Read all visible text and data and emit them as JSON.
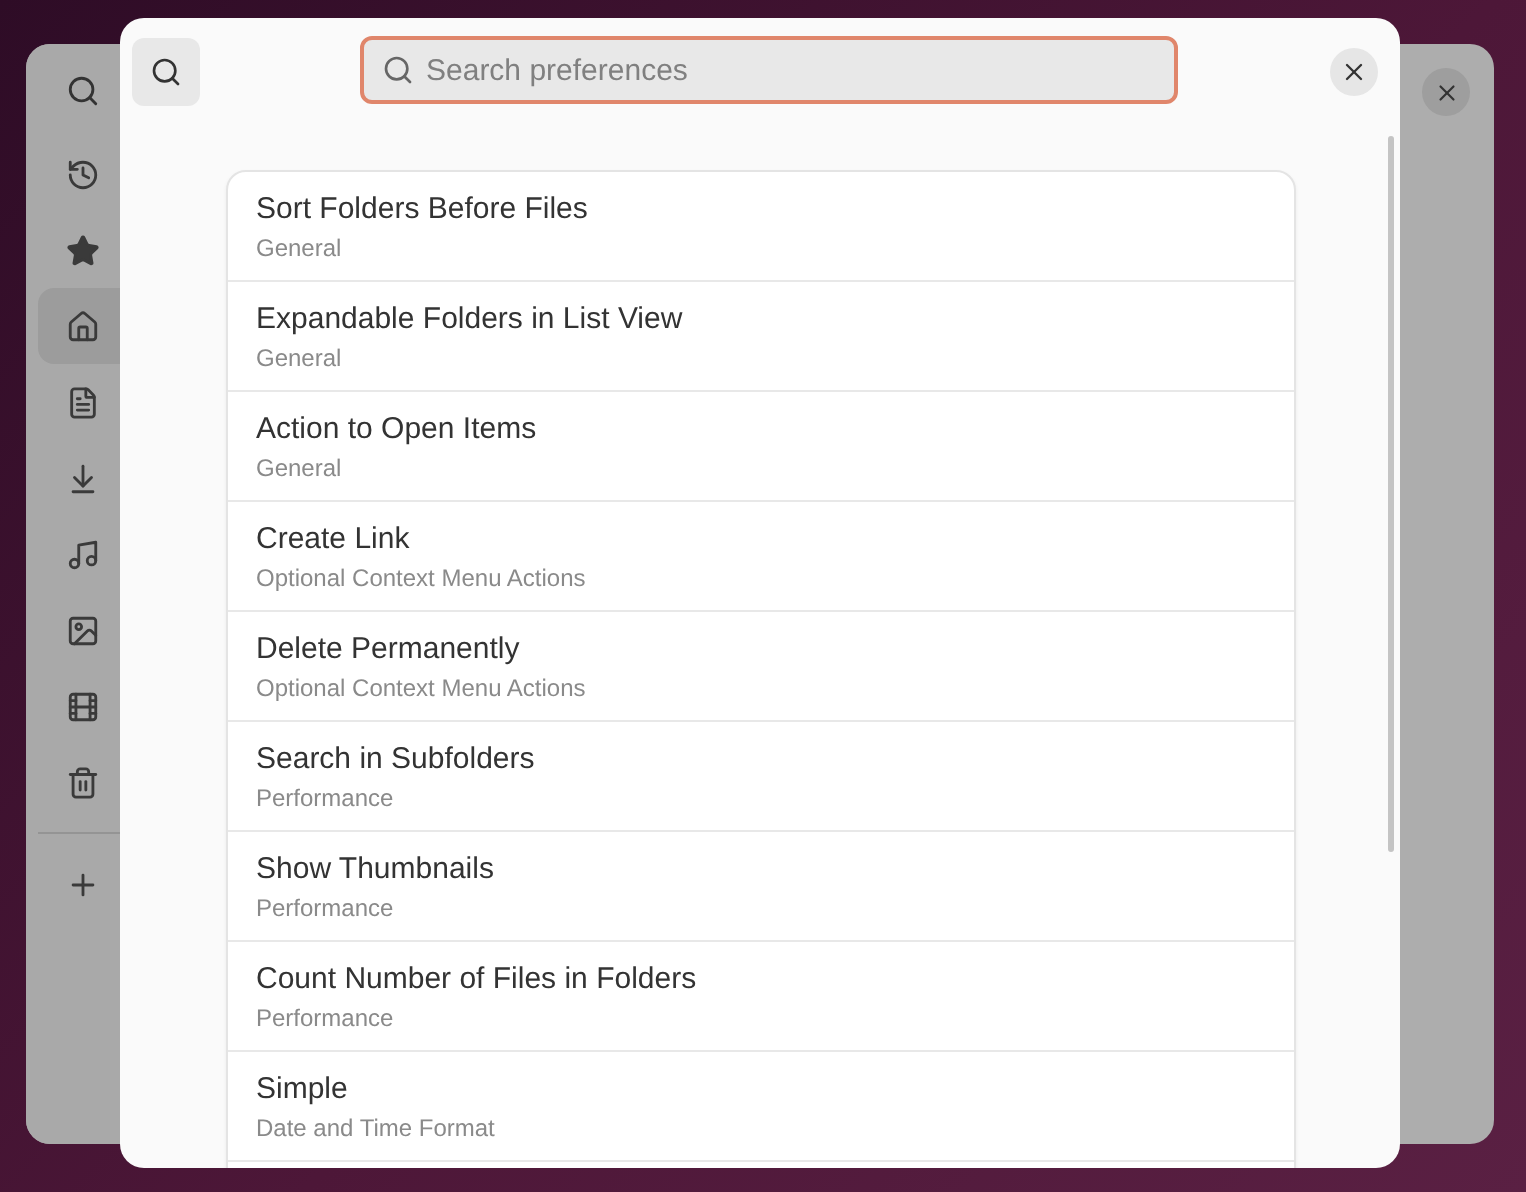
{
  "background_window": {
    "sidebar": [
      {
        "kind": "recent",
        "selected": false
      },
      {
        "kind": "starred",
        "selected": false
      },
      {
        "kind": "home",
        "selected": true
      },
      {
        "kind": "documents",
        "selected": false
      },
      {
        "kind": "downloads",
        "selected": false
      },
      {
        "kind": "music",
        "selected": false
      },
      {
        "kind": "pictures",
        "selected": false
      },
      {
        "kind": "videos",
        "selected": false
      },
      {
        "kind": "trash",
        "selected": false
      },
      {
        "kind": "add",
        "selected": false
      }
    ]
  },
  "dialog": {
    "search": {
      "placeholder": "Search preferences"
    },
    "results": [
      {
        "title": "Sort Folders Before Files",
        "section": "General"
      },
      {
        "title": "Expandable Folders in List View",
        "section": "General"
      },
      {
        "title": "Action to Open Items",
        "section": "General"
      },
      {
        "title": "Create Link",
        "section": "Optional Context Menu Actions"
      },
      {
        "title": "Delete Permanently",
        "section": "Optional Context Menu Actions"
      },
      {
        "title": "Search in Subfolders",
        "section": "Performance"
      },
      {
        "title": "Show Thumbnails",
        "section": "Performance"
      },
      {
        "title": "Count Number of Files in Folders",
        "section": "Performance"
      },
      {
        "title": "Simple",
        "section": "Date and Time Format"
      }
    ]
  }
}
